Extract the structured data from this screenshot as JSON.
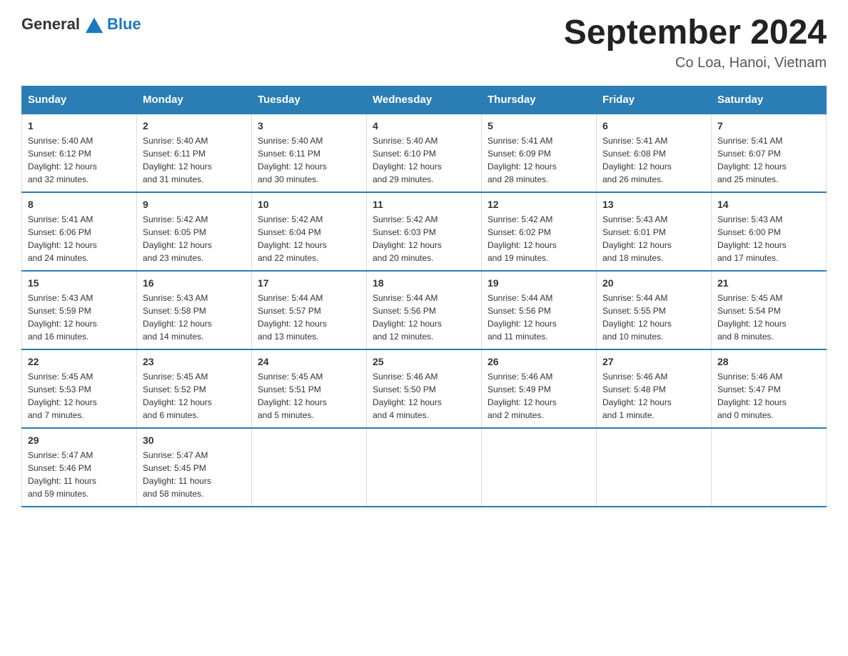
{
  "header": {
    "logo_general": "General",
    "logo_blue": "Blue",
    "month_title": "September 2024",
    "location": "Co Loa, Hanoi, Vietnam"
  },
  "days_of_week": [
    "Sunday",
    "Monday",
    "Tuesday",
    "Wednesday",
    "Thursday",
    "Friday",
    "Saturday"
  ],
  "weeks": [
    [
      {
        "day": "1",
        "info": "Sunrise: 5:40 AM\nSunset: 6:12 PM\nDaylight: 12 hours\nand 32 minutes."
      },
      {
        "day": "2",
        "info": "Sunrise: 5:40 AM\nSunset: 6:11 PM\nDaylight: 12 hours\nand 31 minutes."
      },
      {
        "day": "3",
        "info": "Sunrise: 5:40 AM\nSunset: 6:11 PM\nDaylight: 12 hours\nand 30 minutes."
      },
      {
        "day": "4",
        "info": "Sunrise: 5:40 AM\nSunset: 6:10 PM\nDaylight: 12 hours\nand 29 minutes."
      },
      {
        "day": "5",
        "info": "Sunrise: 5:41 AM\nSunset: 6:09 PM\nDaylight: 12 hours\nand 28 minutes."
      },
      {
        "day": "6",
        "info": "Sunrise: 5:41 AM\nSunset: 6:08 PM\nDaylight: 12 hours\nand 26 minutes."
      },
      {
        "day": "7",
        "info": "Sunrise: 5:41 AM\nSunset: 6:07 PM\nDaylight: 12 hours\nand 25 minutes."
      }
    ],
    [
      {
        "day": "8",
        "info": "Sunrise: 5:41 AM\nSunset: 6:06 PM\nDaylight: 12 hours\nand 24 minutes."
      },
      {
        "day": "9",
        "info": "Sunrise: 5:42 AM\nSunset: 6:05 PM\nDaylight: 12 hours\nand 23 minutes."
      },
      {
        "day": "10",
        "info": "Sunrise: 5:42 AM\nSunset: 6:04 PM\nDaylight: 12 hours\nand 22 minutes."
      },
      {
        "day": "11",
        "info": "Sunrise: 5:42 AM\nSunset: 6:03 PM\nDaylight: 12 hours\nand 20 minutes."
      },
      {
        "day": "12",
        "info": "Sunrise: 5:42 AM\nSunset: 6:02 PM\nDaylight: 12 hours\nand 19 minutes."
      },
      {
        "day": "13",
        "info": "Sunrise: 5:43 AM\nSunset: 6:01 PM\nDaylight: 12 hours\nand 18 minutes."
      },
      {
        "day": "14",
        "info": "Sunrise: 5:43 AM\nSunset: 6:00 PM\nDaylight: 12 hours\nand 17 minutes."
      }
    ],
    [
      {
        "day": "15",
        "info": "Sunrise: 5:43 AM\nSunset: 5:59 PM\nDaylight: 12 hours\nand 16 minutes."
      },
      {
        "day": "16",
        "info": "Sunrise: 5:43 AM\nSunset: 5:58 PM\nDaylight: 12 hours\nand 14 minutes."
      },
      {
        "day": "17",
        "info": "Sunrise: 5:44 AM\nSunset: 5:57 PM\nDaylight: 12 hours\nand 13 minutes."
      },
      {
        "day": "18",
        "info": "Sunrise: 5:44 AM\nSunset: 5:56 PM\nDaylight: 12 hours\nand 12 minutes."
      },
      {
        "day": "19",
        "info": "Sunrise: 5:44 AM\nSunset: 5:56 PM\nDaylight: 12 hours\nand 11 minutes."
      },
      {
        "day": "20",
        "info": "Sunrise: 5:44 AM\nSunset: 5:55 PM\nDaylight: 12 hours\nand 10 minutes."
      },
      {
        "day": "21",
        "info": "Sunrise: 5:45 AM\nSunset: 5:54 PM\nDaylight: 12 hours\nand 8 minutes."
      }
    ],
    [
      {
        "day": "22",
        "info": "Sunrise: 5:45 AM\nSunset: 5:53 PM\nDaylight: 12 hours\nand 7 minutes."
      },
      {
        "day": "23",
        "info": "Sunrise: 5:45 AM\nSunset: 5:52 PM\nDaylight: 12 hours\nand 6 minutes."
      },
      {
        "day": "24",
        "info": "Sunrise: 5:45 AM\nSunset: 5:51 PM\nDaylight: 12 hours\nand 5 minutes."
      },
      {
        "day": "25",
        "info": "Sunrise: 5:46 AM\nSunset: 5:50 PM\nDaylight: 12 hours\nand 4 minutes."
      },
      {
        "day": "26",
        "info": "Sunrise: 5:46 AM\nSunset: 5:49 PM\nDaylight: 12 hours\nand 2 minutes."
      },
      {
        "day": "27",
        "info": "Sunrise: 5:46 AM\nSunset: 5:48 PM\nDaylight: 12 hours\nand 1 minute."
      },
      {
        "day": "28",
        "info": "Sunrise: 5:46 AM\nSunset: 5:47 PM\nDaylight: 12 hours\nand 0 minutes."
      }
    ],
    [
      {
        "day": "29",
        "info": "Sunrise: 5:47 AM\nSunset: 5:46 PM\nDaylight: 11 hours\nand 59 minutes."
      },
      {
        "day": "30",
        "info": "Sunrise: 5:47 AM\nSunset: 5:45 PM\nDaylight: 11 hours\nand 58 minutes."
      },
      {
        "day": "",
        "info": ""
      },
      {
        "day": "",
        "info": ""
      },
      {
        "day": "",
        "info": ""
      },
      {
        "day": "",
        "info": ""
      },
      {
        "day": "",
        "info": ""
      }
    ]
  ]
}
